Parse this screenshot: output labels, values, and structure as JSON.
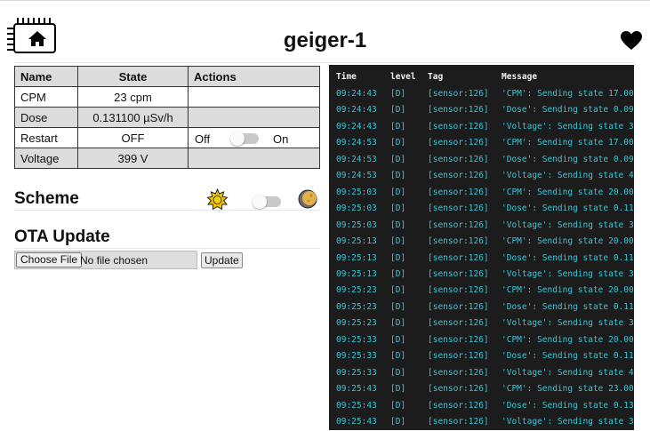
{
  "header": {
    "title": "geiger-1"
  },
  "entities": {
    "columns": {
      "name": "Name",
      "state": "State",
      "actions": "Actions"
    },
    "rows": [
      {
        "name": "CPM",
        "state": "23 cpm"
      },
      {
        "name": "Dose",
        "state": "0.131100 µSv/h"
      },
      {
        "name": "Restart",
        "state": "OFF",
        "action_off": "Off",
        "action_on": "On"
      },
      {
        "name": "Voltage",
        "state": "399 V"
      }
    ]
  },
  "scheme": {
    "heading": "Scheme"
  },
  "ota": {
    "heading": "OTA Update",
    "choose_file": "Choose File",
    "file_status": "No file chosen",
    "update_button": "Update"
  },
  "log": {
    "headers": {
      "time": "Time",
      "level": "level",
      "tag": "Tag",
      "message": "Message"
    },
    "rows": [
      {
        "time": "09:24:43",
        "level": "[D]",
        "tag": "[sensor:126]",
        "message": "'CPM': Sending state 17.00"
      },
      {
        "time": "09:24:43",
        "level": "[D]",
        "tag": "[sensor:126]",
        "message": "'Dose': Sending state 0.09"
      },
      {
        "time": "09:24:43",
        "level": "[D]",
        "tag": "[sensor:126]",
        "message": "'Voltage': Sending state 3"
      },
      {
        "time": "09:24:53",
        "level": "[D]",
        "tag": "[sensor:126]",
        "message": "'CPM': Sending state 17.00"
      },
      {
        "time": "09:24:53",
        "level": "[D]",
        "tag": "[sensor:126]",
        "message": "'Dose': Sending state 0.09"
      },
      {
        "time": "09:24:53",
        "level": "[D]",
        "tag": "[sensor:126]",
        "message": "'Voltage': Sending state 4"
      },
      {
        "time": "09:25:03",
        "level": "[D]",
        "tag": "[sensor:126]",
        "message": "'CPM': Sending state 20.00"
      },
      {
        "time": "09:25:03",
        "level": "[D]",
        "tag": "[sensor:126]",
        "message": "'Dose': Sending state 0.11"
      },
      {
        "time": "09:25:03",
        "level": "[D]",
        "tag": "[sensor:126]",
        "message": "'Voltage': Sending state 3"
      },
      {
        "time": "09:25:13",
        "level": "[D]",
        "tag": "[sensor:126]",
        "message": "'CPM': Sending state 20.00"
      },
      {
        "time": "09:25:13",
        "level": "[D]",
        "tag": "[sensor:126]",
        "message": "'Dose': Sending state 0.11"
      },
      {
        "time": "09:25:13",
        "level": "[D]",
        "tag": "[sensor:126]",
        "message": "'Voltage': Sending state 3"
      },
      {
        "time": "09:25:23",
        "level": "[D]",
        "tag": "[sensor:126]",
        "message": "'CPM': Sending state 20.00"
      },
      {
        "time": "09:25:23",
        "level": "[D]",
        "tag": "[sensor:126]",
        "message": "'Dose': Sending state 0.11"
      },
      {
        "time": "09:25:23",
        "level": "[D]",
        "tag": "[sensor:126]",
        "message": "'Voltage': Sending state 3"
      },
      {
        "time": "09:25:33",
        "level": "[D]",
        "tag": "[sensor:126]",
        "message": "'CPM': Sending state 20.00"
      },
      {
        "time": "09:25:33",
        "level": "[D]",
        "tag": "[sensor:126]",
        "message": "'Dose': Sending state 0.11"
      },
      {
        "time": "09:25:33",
        "level": "[D]",
        "tag": "[sensor:126]",
        "message": "'Voltage': Sending state 4"
      },
      {
        "time": "09:25:43",
        "level": "[D]",
        "tag": "[sensor:126]",
        "message": "'CPM': Sending state 23.00"
      },
      {
        "time": "09:25:43",
        "level": "[D]",
        "tag": "[sensor:126]",
        "message": "'Dose': Sending state 0.13"
      },
      {
        "time": "09:25:43",
        "level": "[D]",
        "tag": "[sensor:126]",
        "message": "'Voltage': Sending state 3"
      }
    ]
  },
  "colors": {
    "log_background": "#1c1c1c",
    "log_text": "#39c6d8",
    "header_row": "#dcdcdc"
  },
  "icons": {
    "logo": "chip-home-icon",
    "favorite": "heart-icon",
    "light": "sun-icon",
    "dark": "moon-icon"
  }
}
